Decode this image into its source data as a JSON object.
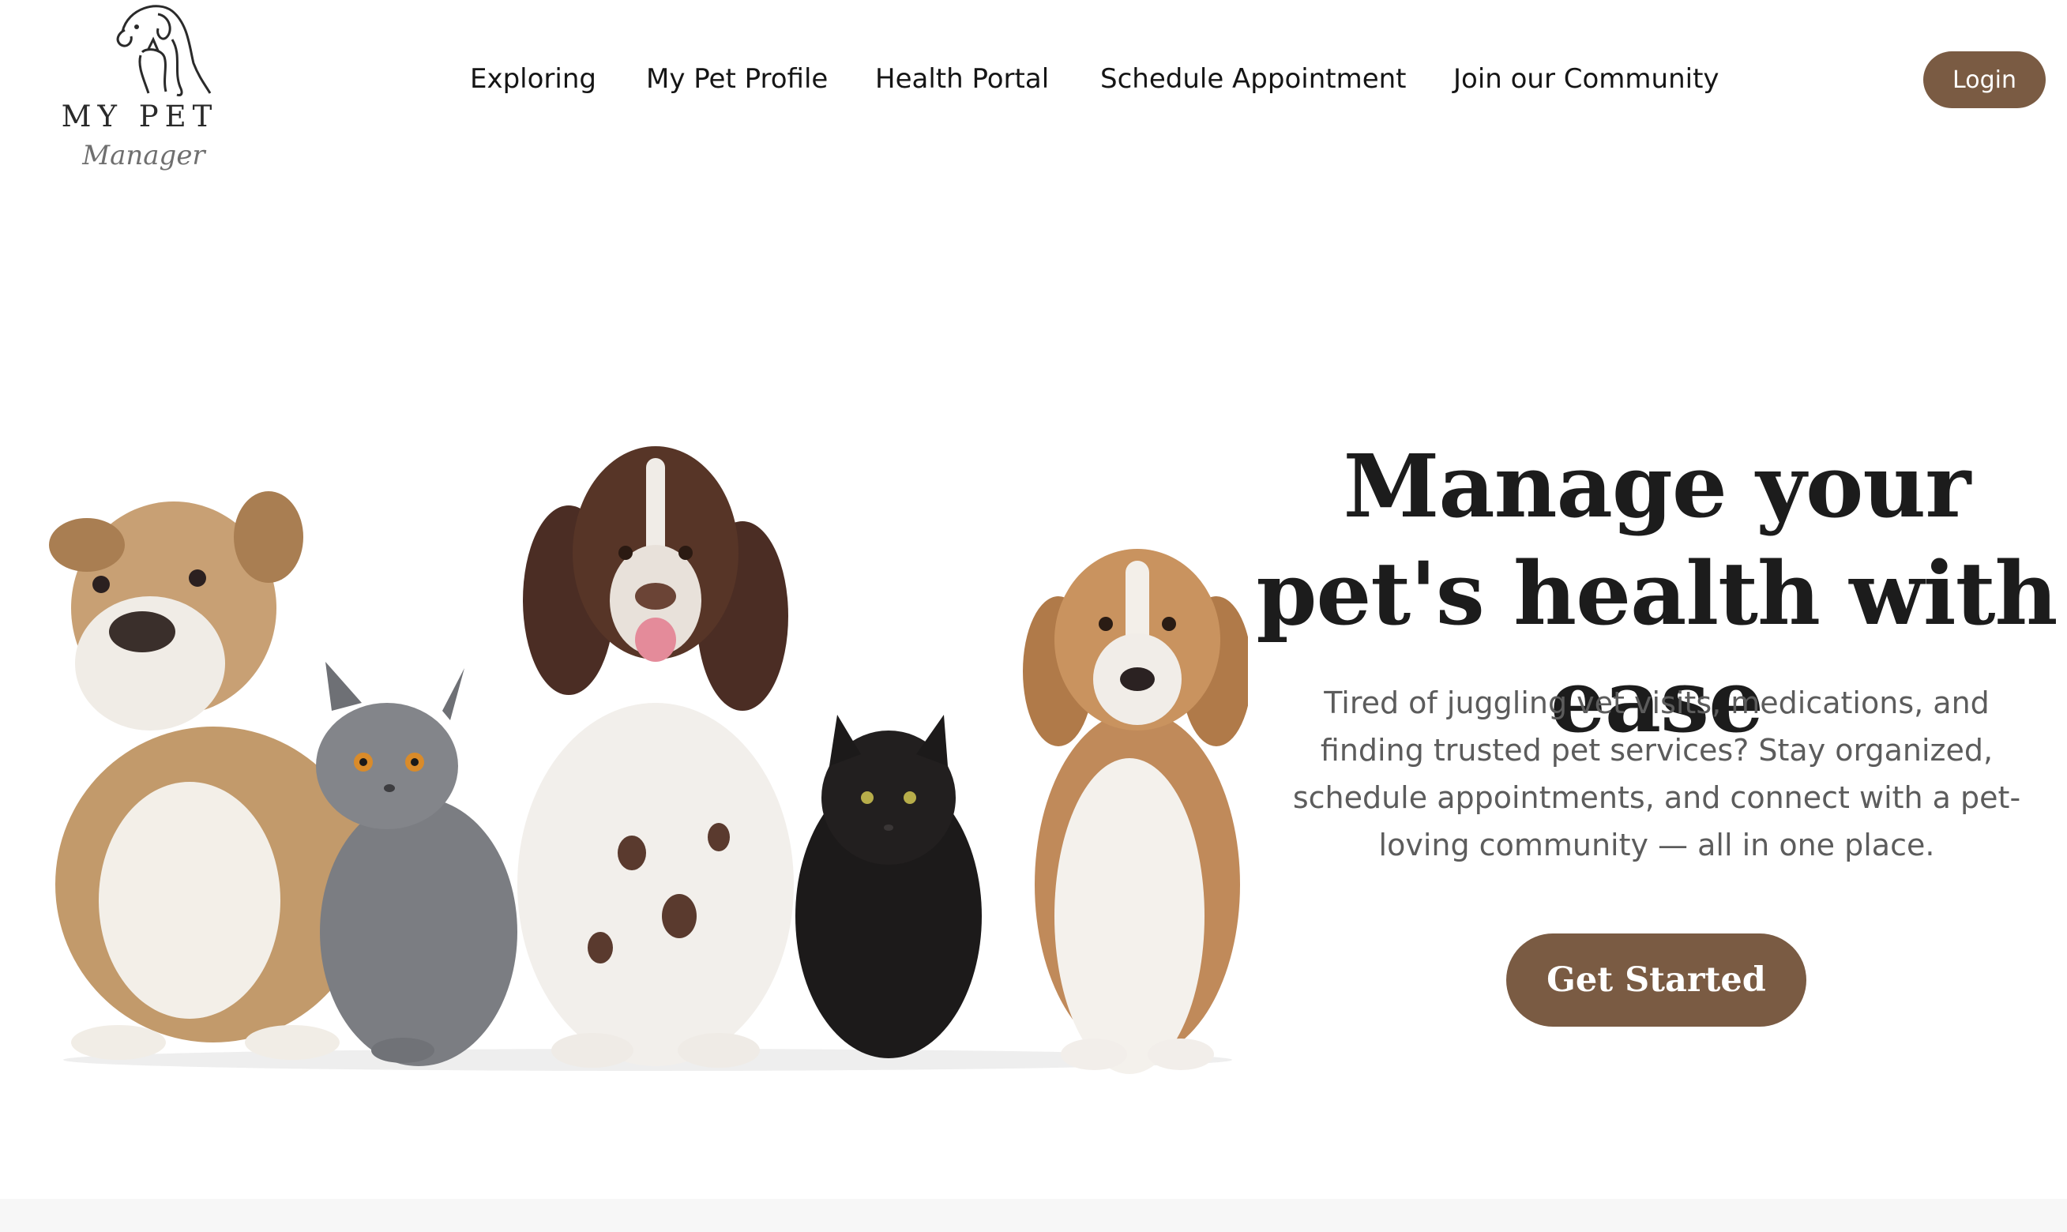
{
  "brand": {
    "logo_line1": "MY PET",
    "logo_line2": "Manager",
    "logo_icon": "dog-and-cat-outline-icon"
  },
  "nav": {
    "items": [
      {
        "label": "Exploring"
      },
      {
        "label": "My Pet Profile"
      },
      {
        "label": "Health Portal"
      },
      {
        "label": "Schedule Appointment"
      },
      {
        "label": "Join our Community"
      }
    ],
    "login_label": "Login"
  },
  "hero": {
    "title": "Manage your pet's health with ease",
    "subtitle": "Tired of juggling vet visits, medications, and finding trusted pet services? Stay organized, schedule appointments, and connect with a pet-loving community — all in one place.",
    "cta_label": "Get Started",
    "image_subject": "bulldog, grey cat, spaniel, black cat and beagle sitting in a row"
  },
  "colors": {
    "accent": "#7a5b43",
    "text": "#1c1c1c",
    "muted_text": "#5c5c5c",
    "background": "#ffffff"
  }
}
